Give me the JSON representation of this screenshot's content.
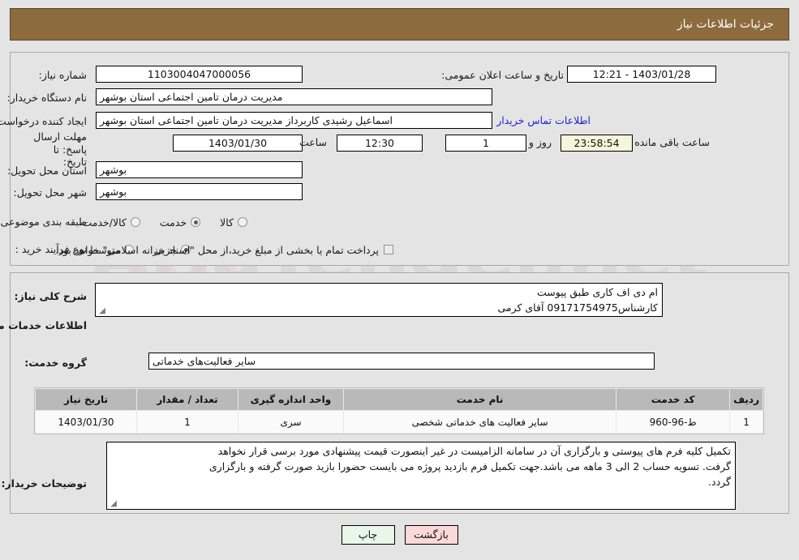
{
  "header": {
    "title": "جزئیات اطلاعات نیاز"
  },
  "top_panel": {
    "need_number": {
      "label": "شماره نیاز:",
      "value": "1103004047000056"
    },
    "announce": {
      "label": "تاریخ و ساعت اعلان عمومی:",
      "value": "1403/01/28 - 12:21"
    },
    "buyer_org": {
      "label": "نام دستگاه خریدار:",
      "value": "مدیریت درمان تامین اجتماعی استان بوشهر"
    },
    "requester": {
      "label": "ایجاد کننده درخواست:",
      "value": "اسماعیل رشیدی کاربرداز مدیریت درمان تامین اجتماعی استان بوشهر",
      "contact_link": "اطلاعات تماس خریدار"
    },
    "deadline": {
      "label_line1": "مهلت ارسال پاسخ: تا",
      "label_line2": "تاریخ:",
      "date": "1403/01/30",
      "hour_label": "ساعت",
      "hour": "12:30",
      "days": "1",
      "days_label": "روز و",
      "countdown": "23:58:54",
      "countdown_label": "ساعت باقی مانده"
    },
    "province": {
      "label": "استان محل تحویل:",
      "value": "بوشهر"
    },
    "city": {
      "label": "شهر محل تحویل:",
      "value": "بوشهر"
    },
    "category": {
      "label": "طبقه بندی موضوعی:",
      "options": [
        {
          "label": "کالا",
          "selected": false
        },
        {
          "label": "خدمت",
          "selected": true
        },
        {
          "label": "کالا/خدمت",
          "selected": false
        }
      ]
    },
    "process_type": {
      "label": "نوع فرآیند خرید :",
      "options": [
        {
          "label": "جزیی",
          "selected": true
        },
        {
          "label": "متوسط",
          "selected": false
        }
      ],
      "checkbox_label": "پرداخت تمام یا بخشی از مبلغ خرید،از محل \"اسناد خزانه اسلامی\" خواهد بود.",
      "checkbox_checked": false
    }
  },
  "bottom_panel": {
    "summary": {
      "label": "شرح کلی نیاز:",
      "line1": "ام دی اف کاری طبق پیوست",
      "line2": "کارشناس09171754975 آقای کرمی"
    },
    "section_title": "اطلاعات خدمات مورد نیاز",
    "service_group": {
      "label": "گروه خدمت:",
      "value": "سایر فعالیت‌های خدماتی"
    },
    "table": {
      "columns": [
        "ردیف",
        "کد خدمت",
        "نام خدمت",
        "واحد اندازه گیری",
        "تعداد / مقدار",
        "تاریخ نیاز"
      ],
      "rows": [
        [
          "1",
          "ط-96-960",
          "سایر فعالیت های خدماتی شخصی",
          "سری",
          "1",
          "1403/01/30"
        ]
      ]
    },
    "buyer_notes": {
      "label": "توضیحات خریدار:",
      "line1": "تکمیل کلیه فرم های پیوستی و بارگزاری آن در سامانه الزامیست در غیر اینصورت قیمت پیشنهادی مورد برسی قرار نخواهد",
      "line2": "گرفت. تسویه حساب 2 الی 3 ماهه می باشد.جهت تکمیل فرم بازدید پروژه می بایست حضورا بازید صورت گرفته و بارگزاری",
      "line3": "گردد."
    }
  },
  "buttons": {
    "print": "چاپ",
    "back": "بازگشت"
  },
  "colors": {
    "header_bg": "#8c6b3f",
    "page_bg": "#e4e4e4",
    "link": "#1f22d8",
    "table_header": "#b9b9b9",
    "print_btn": "#e8f7e8",
    "back_btn": "#fbd9d9",
    "counter_bg": "#f5f5dc"
  }
}
